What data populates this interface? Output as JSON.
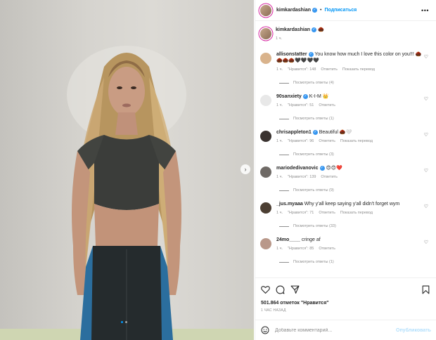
{
  "post": {
    "username": "kimkardashian",
    "follow_label": "Подписаться",
    "separator": "•",
    "more_icon": "more-horizontal-icon"
  },
  "caption": {
    "username": "kimkardashian",
    "emoji": "🌰",
    "time": "1 ч."
  },
  "comments": [
    {
      "username": "allisonstatter",
      "text": "You know how much I love this color on you!!! 🌰🌰🌰🌰🖤🖤🖤🖤",
      "verified": true,
      "time": "1 ч.",
      "likes": "\"Нравится\": 148",
      "reply": "Ответить",
      "translate": "Показать перевод",
      "replies": "Посмотреть ответы (4)"
    },
    {
      "username": "90sanxiety",
      "text": "K-I-M 👑",
      "verified": true,
      "time": "1 ч.",
      "likes": "\"Нравится\": 51",
      "reply": "Ответить",
      "translate": "",
      "replies": "Посмотреть ответы (1)"
    },
    {
      "username": "chrisappleton1",
      "text": "Beautiful 🌰🤍",
      "verified": true,
      "time": "1 ч.",
      "likes": "\"Нравится\": 96",
      "reply": "Ответить",
      "translate": "Показать перевод",
      "replies": "Посмотреть ответы (3)"
    },
    {
      "username": "mariodedivanovic",
      "text": "😍😍❤️",
      "verified": true,
      "time": "1 ч.",
      "likes": "\"Нравится\": 139",
      "reply": "Ответить",
      "translate": "",
      "replies": "Посмотреть ответы (9)"
    },
    {
      "username": "_jus.myaaa",
      "text": "Why y'all keep saying y'all didn't forget wym",
      "verified": false,
      "time": "1 ч.",
      "likes": "\"Нравится\": 71",
      "reply": "Ответить",
      "translate": "Показать перевод",
      "replies": "Посмотреть ответы (33)"
    },
    {
      "username": "24mo____",
      "text": "cringe af",
      "verified": false,
      "time": "1 ч.",
      "likes": "\"Нравится\": 85",
      "reply": "Ответить",
      "translate": "",
      "replies": "Посмотреть ответы (1)"
    }
  ],
  "actions": {
    "likes_text": "501.864 отметок \"Нравится\"",
    "timestamp": "1 ЧАС НАЗАД"
  },
  "add_comment": {
    "placeholder": "Добавьте комментарий...",
    "post_label": "Опубликовать"
  },
  "carousel": {
    "current": 1,
    "total": 2
  },
  "colors": {
    "accent": "#0095f6",
    "verified": "#3897f0",
    "post_disabled": "#b2dffc"
  }
}
